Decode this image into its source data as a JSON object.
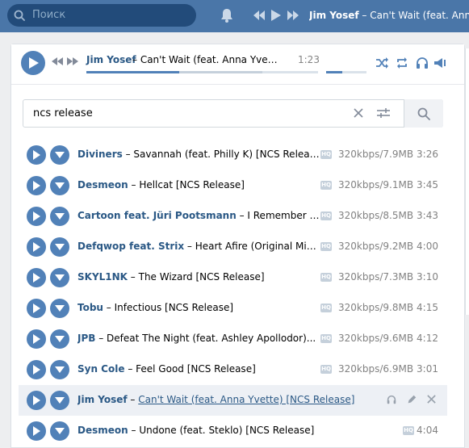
{
  "topbar": {
    "search_placeholder": "Поиск",
    "now_artist": "Jim Yosef",
    "now_title": " – Can't Wait (feat. Anna Yvette) [NCS Release]"
  },
  "player": {
    "artist": "Jim Yosef",
    "title": " – Can't Wait (feat. Anna Yvett...",
    "time": "1:23",
    "progress": 0.4,
    "buffered": 0.76,
    "volume": 0.4
  },
  "search": {
    "value": "ncs release"
  },
  "tracks": [
    {
      "artist": "Diviners",
      "title": "Savannah (feat. Philly K) [NCS Releas...",
      "quality": "HQ",
      "meta": "320kbps/7.9MB",
      "duration": "3:26"
    },
    {
      "artist": "Desmeon",
      "title": "Hellcat [NCS Release]",
      "quality": "HQ",
      "meta": "320kbps/9.1MB",
      "duration": "3:45"
    },
    {
      "artist": "Cartoon feat. Jüri Pootsmann",
      "title": "I Remember U (...",
      "quality": "HQ",
      "meta": "320kbps/8.5MB",
      "duration": "3:43"
    },
    {
      "artist": "Defqwop feat. Strix",
      "title": "Heart Afire (Original Mix) [...",
      "quality": "HQ",
      "meta": "320kbps/9.2MB",
      "duration": "4:00"
    },
    {
      "artist": "SKYL1NK",
      "title": "The Wizard [NCS Release]",
      "quality": "HQ",
      "meta": "320kbps/7.3MB",
      "duration": "3:10"
    },
    {
      "artist": "Tobu",
      "title": "Infectious [NCS Release]",
      "quality": "HQ",
      "meta": "320kbps/9.8MB",
      "duration": "4:15"
    },
    {
      "artist": "JPB",
      "title": "Defeat The Night (feat. Ashley Apollodor)...",
      "quality": "HQ",
      "meta": "320kbps/9.6MB",
      "duration": "4:12"
    },
    {
      "artist": "Syn Cole",
      "title": "Feel Good [NCS Release]",
      "quality": "HQ",
      "meta": "320kbps/6.9MB",
      "duration": "3:01"
    },
    {
      "artist": "Jim Yosef",
      "title": "Can't Wait (feat. Anna Yvette) [NCS Release]",
      "active": true
    },
    {
      "artist": "Desmeon",
      "title": "Undone (feat. Steklo) [NCS Release]",
      "quality": "HQ",
      "duration": "4:04"
    }
  ],
  "colors": {
    "topbar": "#4a76a8",
    "accent": "#5181b8",
    "link": "#2a5885",
    "muted": "#828282"
  }
}
